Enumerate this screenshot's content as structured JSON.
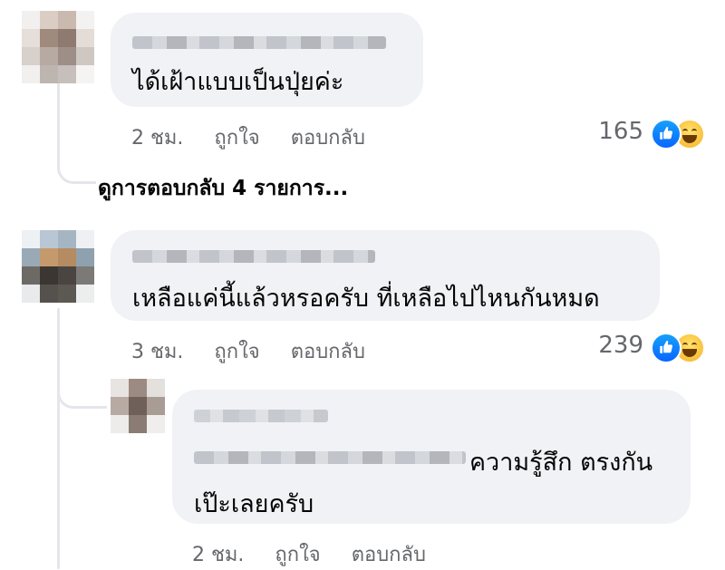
{
  "comments": [
    {
      "text": "ได้เฝ้าแบบเป็นปุ่ยค่ะ",
      "time": "2 ชม.",
      "like_label": "ถูกใจ",
      "reply_label": "ตอบกลับ",
      "reaction_count": "165",
      "reactions": [
        "like-icon",
        "haha-icon"
      ]
    },
    {
      "text": "เหลือแค่นี้แล้วหรอครับ ที่เหลือไปไหนกันหมด",
      "time": "3 ชม.",
      "like_label": "ถูกใจ",
      "reply_label": "ตอบกลับ",
      "reaction_count": "239",
      "reactions": [
        "like-icon",
        "haha-icon"
      ]
    }
  ],
  "view_replies": "ดูการตอบกลับ 4 รายการ...",
  "reply": {
    "text_line1": "ความรู้สึก ตรงกัน",
    "text_line2": "เป๊ะเลยครับ",
    "time": "2 ชม.",
    "like_label": "ถูกใจ",
    "reply_label": "ตอบกลับ"
  },
  "colors": {
    "bubble": "#f0f2f5",
    "meta_text": "#65676b",
    "like_blue": "#0866ff",
    "haha_yellow": "#f7b125"
  }
}
